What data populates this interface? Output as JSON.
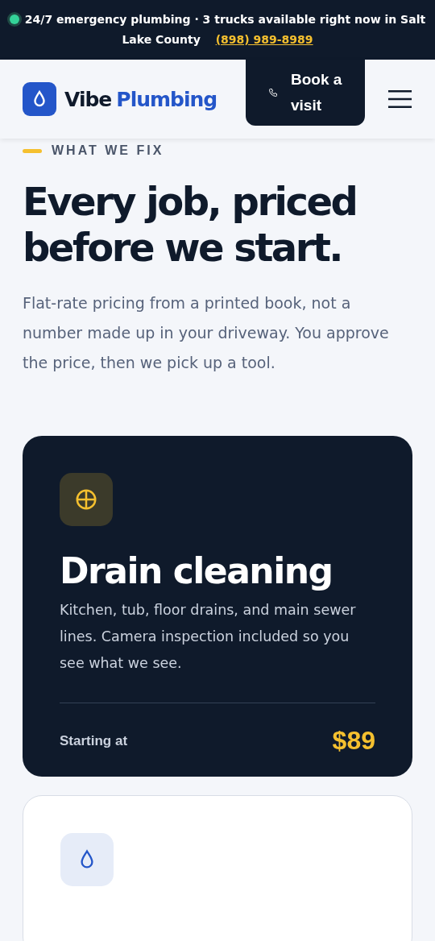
{
  "announcement": {
    "live": true,
    "text": "24/7 emergency plumbing · 3 trucks available right now in Salt Lake County",
    "phone": "(898) 989-8989"
  },
  "header": {
    "brand_first": "Vibe",
    "brand_second": "Plumbing",
    "cta": "Book a visit"
  },
  "section": {
    "eyebrow": "WHAT WE FIX",
    "title": "Every job, priced before we start.",
    "intro": "Flat-rate pricing from a printed book, not a number made up in your driveway. You approve the price, then we pick up a tool."
  },
  "services": [
    {
      "featured": true,
      "kind": "drain",
      "title": "Drain cleaning",
      "description": "Kitchen, tub, floor drains, and main sewer lines. Camera inspection included so you see what we see.",
      "price_label": "Starting at",
      "price": "$89"
    },
    {
      "featured": false,
      "kind": "drop"
    }
  ]
}
